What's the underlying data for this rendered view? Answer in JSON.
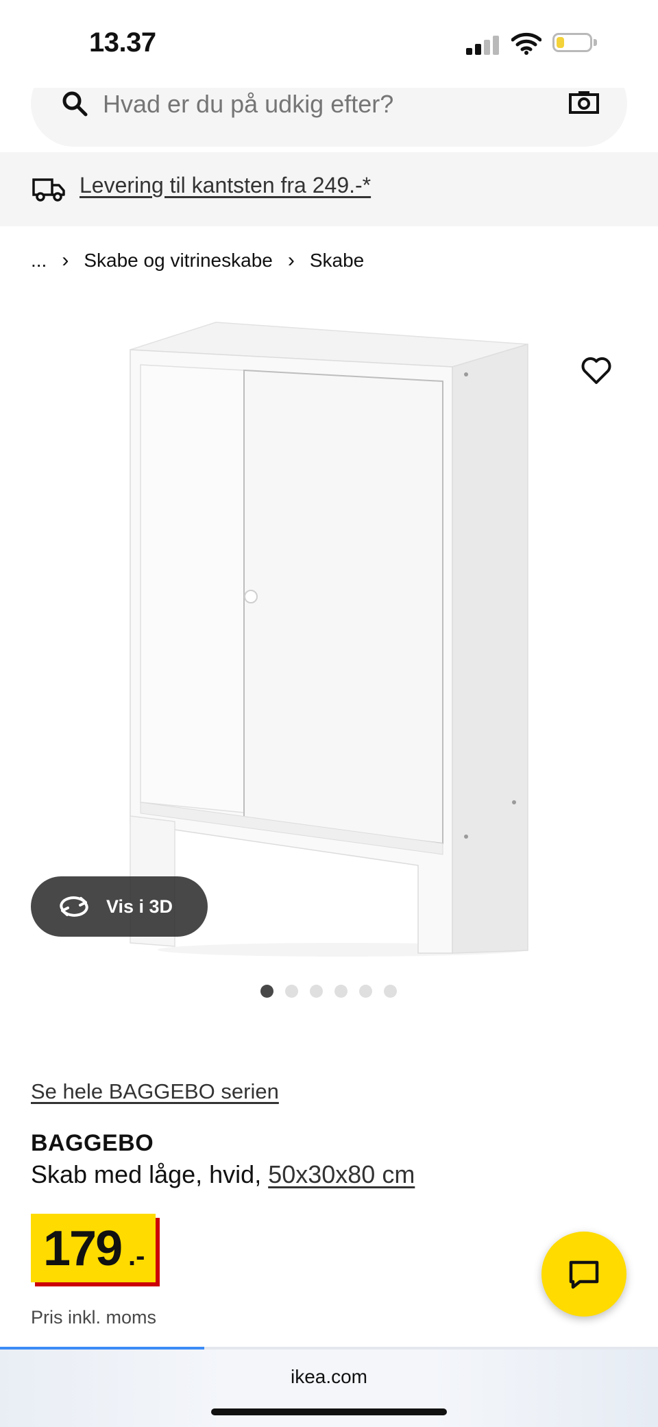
{
  "status_bar": {
    "time": "13.37"
  },
  "search": {
    "placeholder": "Hvad er du på udkig efter?"
  },
  "delivery": {
    "text": "Levering til kantsten fra 249.-*"
  },
  "breadcrumb": {
    "items": [
      "...",
      "Skabe og vitrineskabe",
      "Skabe"
    ]
  },
  "gallery": {
    "view_3d_label": "Vis i 3D",
    "dot_count": 6,
    "active_dot": 0
  },
  "product": {
    "series_link": "Se hele BAGGEBO serien",
    "name": "BAGGEBO",
    "description": "Skab med låge, hvid, ",
    "dimensions": "50x30x80 cm",
    "price_integer": "179",
    "price_suffix": ".-",
    "price_note": "Pris inkl. moms"
  },
  "browser": {
    "url": "ikea.com",
    "load_progress": 0.31
  },
  "colors": {
    "accent_yellow": "#ffdb00",
    "price_red": "#cc0008",
    "progress_blue": "#3b8bf5"
  }
}
